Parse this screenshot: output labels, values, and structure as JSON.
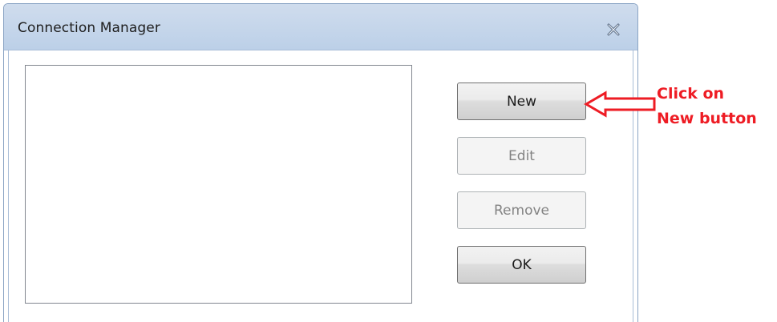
{
  "window": {
    "title": "Connection Manager",
    "close_icon": "close-x-icon"
  },
  "connection_list": {
    "items": []
  },
  "buttons": {
    "new_label": "New",
    "edit_label": "Edit",
    "remove_label": "Remove",
    "ok_label": "OK"
  },
  "annotation": {
    "line1": "Click on",
    "line2": "New button",
    "color": "#ee1c24",
    "arrow_icon": "left-arrow-icon"
  }
}
